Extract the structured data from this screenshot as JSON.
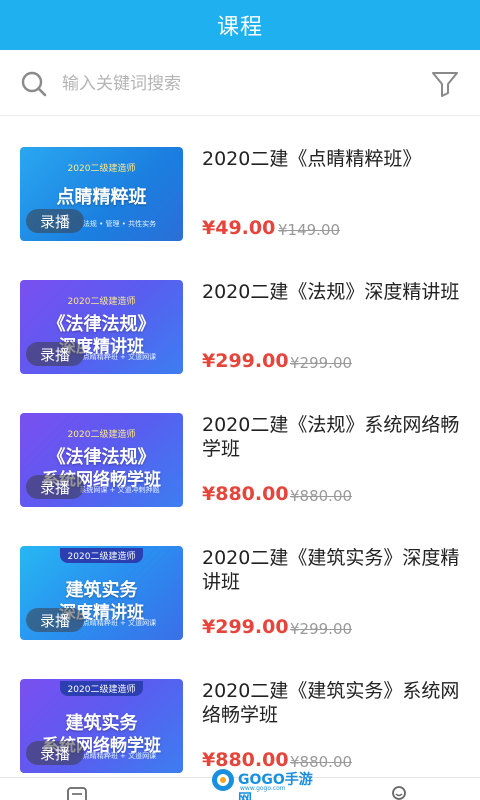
{
  "header": {
    "title": "课程"
  },
  "search": {
    "placeholder": "输入关键词搜索"
  },
  "courses": [
    {
      "thumb_sub": "2020二级建造师",
      "thumb_main1": "点睛精粹班",
      "thumb_main2": "",
      "thumb_detail": "法规 • 管理 • 共性实务",
      "badge": "录播",
      "title": "2020二建《点睛精粹班》",
      "price": "¥49.00",
      "orig": "¥149.00"
    },
    {
      "thumb_sub": "2020二级建造师",
      "thumb_main1": "《法律法规》",
      "thumb_main2": "深度精讲班",
      "thumb_detail": "点睛精粹班 + 文道网课",
      "badge": "录播",
      "title": "2020二建《法规》深度精讲班",
      "price": "¥299.00",
      "orig": "¥299.00"
    },
    {
      "thumb_sub": "2020二级建造师",
      "thumb_main1": "《法律法规》",
      "thumb_main2": "系统网络畅学班",
      "thumb_detail": "系统网课 + 文道冲刺押题",
      "badge": "录播",
      "title": "2020二建《法规》系统网络畅学班",
      "price": "¥880.00",
      "orig": "¥880.00"
    },
    {
      "thumb_sub": "2020二级建造师",
      "thumb_main1": "建筑实务",
      "thumb_main2": "深度精讲班",
      "thumb_detail": "点睛精粹班 + 文道网课",
      "badge": "录播",
      "title": "2020二建《建筑实务》深度精讲班",
      "price": "¥299.00",
      "orig": "¥299.00"
    },
    {
      "thumb_sub": "2020二级建造师",
      "thumb_main1": "建筑实务",
      "thumb_main2": "系统网络畅学班",
      "thumb_detail": "点睛精粹班 + 文道网课",
      "badge": "录播",
      "title": "2020二建《建筑实务》系统网络畅学班",
      "price": "¥880.00",
      "orig": "¥880.00"
    }
  ],
  "watermark": {
    "text": "GOGO手游网",
    "sub": "www.gogo.com"
  },
  "colors": {
    "header": "#1fb0f0",
    "price": "#e5453b"
  },
  "icons": {
    "search": "search-icon",
    "filter": "filter-icon",
    "tab_left": "list-icon",
    "tab_right": "user-icon"
  }
}
